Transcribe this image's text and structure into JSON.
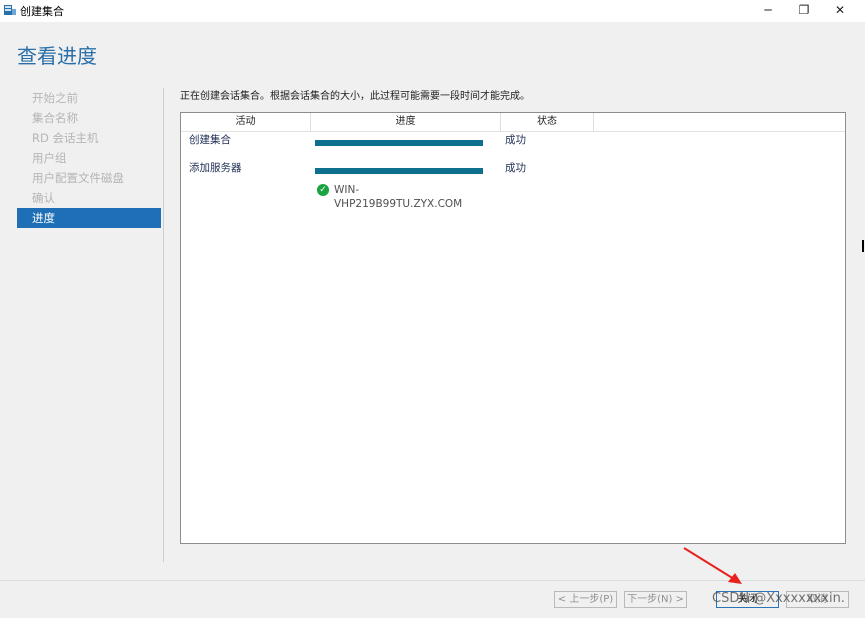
{
  "window": {
    "title": "创建集合",
    "icons": {
      "app": "server-manager-icon",
      "minimize": "minimize-icon",
      "maximize": "restore-icon",
      "close": "close-icon"
    }
  },
  "page_heading": "查看进度",
  "nav": {
    "items": [
      {
        "label": "开始之前",
        "active": false
      },
      {
        "label": "集合名称",
        "active": false
      },
      {
        "label": "RD 会话主机",
        "active": false
      },
      {
        "label": "用户组",
        "active": false
      },
      {
        "label": "用户配置文件磁盘",
        "active": false
      },
      {
        "label": "确认",
        "active": false
      },
      {
        "label": "进度",
        "active": true
      }
    ]
  },
  "main": {
    "intro": "正在创建会话集合。根据会话集合的大小，此过程可能需要一段时间才能完成。",
    "table": {
      "columns": [
        "活动",
        "进度",
        "状态"
      ],
      "rows": [
        {
          "activity": "创建集合",
          "progress": 1.0,
          "status": "成功"
        },
        {
          "activity": "添加服务器",
          "progress": 1.0,
          "status": "成功",
          "details": [
            {
              "icon": "success-check-icon",
              "server": "WIN-VHP219B99TU.ZYX.COM",
              "server_line1": "WIN-",
              "server_line2": "VHP219B99TU.ZYX.COM"
            }
          ]
        }
      ]
    }
  },
  "footer": {
    "prev": "< 上一步(P)",
    "next": "下一步(N) >",
    "close": "关闭",
    "cancel": "取消"
  },
  "watermark": "CSDN @Xxxxxxxxin.",
  "colors": {
    "accent": "#1e6fb5",
    "heading": "#2a6fa8",
    "progress_bar": "#0e6f8e",
    "success": "#1aa340",
    "annotation_arrow": "#e8211f"
  }
}
